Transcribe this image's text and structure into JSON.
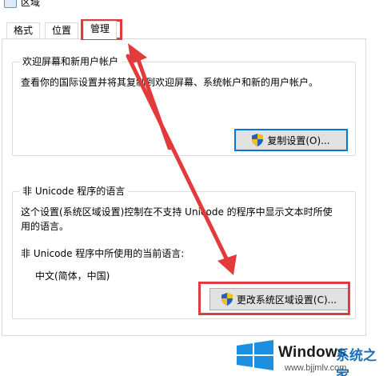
{
  "window": {
    "title": "区域"
  },
  "tabs": [
    {
      "label": "格式"
    },
    {
      "label": "位置"
    },
    {
      "label": "管理"
    }
  ],
  "welcome_group": {
    "title": "欢迎屏幕和新用户帐户",
    "description": "查看你的国际设置并将其复制到欢迎屏幕、系统帐户和新的用户帐户。",
    "copy_button": "复制设置(O)..."
  },
  "unicode_group": {
    "title": "非 Unicode 程序的语言",
    "description_line1": "这个设置(系统区域设置)控制在不支持 Unicode 的程序中显示文本时所使",
    "description_line2": "用的语言。",
    "current_label": "非 Unicode 程序中所使用的当前语言:",
    "current_value": "中文(简体，中国)",
    "change_button": "更改系统区域设置(C)..."
  },
  "watermark": {
    "brand": "Windows",
    "site_cn": "系统之家",
    "url": "www.bjjmlv.com"
  },
  "colors": {
    "annotation_red": "#e23b3b",
    "focus_blue": "#0078d7",
    "button_face": "#e1e1e1"
  }
}
